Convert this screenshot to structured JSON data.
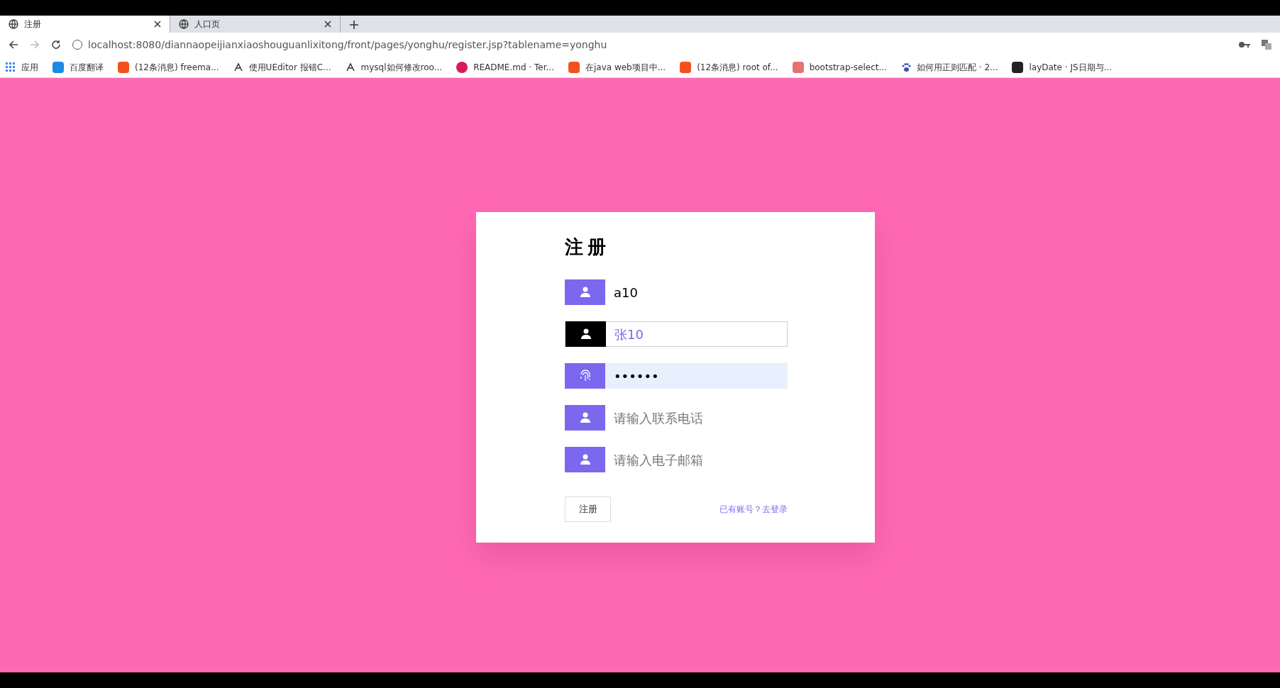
{
  "browser": {
    "tabs": [
      {
        "title": "注册",
        "selected": true
      },
      {
        "title": "人口页",
        "selected": false
      }
    ],
    "address": "localhost:8080/diannaopeijianxiaoshouguanlixitong/front/pages/yonghu/register.jsp?tablename=yonghu",
    "bookmarks": [
      {
        "kind": "apps",
        "label": "应用"
      },
      {
        "kind": "square",
        "color": "#1e88e5",
        "label": "百度翻译"
      },
      {
        "kind": "square",
        "color": "#f4511e",
        "label": "(12条消息) freema..."
      },
      {
        "kind": "glyph",
        "label": "使用UEditor 报错C..."
      },
      {
        "kind": "glyph",
        "label": "mysql如何修改roo..."
      },
      {
        "kind": "circle",
        "color": "#d81b60",
        "label": "README.md · Ter..."
      },
      {
        "kind": "square",
        "color": "#f4511e",
        "label": "在java web项目中..."
      },
      {
        "kind": "square",
        "color": "#f4511e",
        "label": "(12条消息) root of..."
      },
      {
        "kind": "square",
        "color": "#e57373",
        "label": "bootstrap-select..."
      },
      {
        "kind": "paw",
        "color": "#3f51b5",
        "label": "如何用正则匹配 · 2..."
      },
      {
        "kind": "square",
        "color": "#222222",
        "label": "layDate · JS日期与..."
      }
    ]
  },
  "form": {
    "title": "注册",
    "fields": [
      {
        "kind": "user",
        "value": "a10",
        "focused": false,
        "autofilled": false
      },
      {
        "kind": "user",
        "value": "张10",
        "focused": true,
        "autofilled": false
      },
      {
        "kind": "fingerprint",
        "value": "••••••",
        "focused": false,
        "autofilled": true
      },
      {
        "kind": "user",
        "placeholder": "请输入联系电话",
        "focused": false,
        "autofilled": false
      },
      {
        "kind": "user",
        "placeholder": "请输入电子邮箱",
        "focused": false,
        "autofilled": false
      }
    ],
    "submit": "注册",
    "login_link": "已有账号？去登录"
  }
}
